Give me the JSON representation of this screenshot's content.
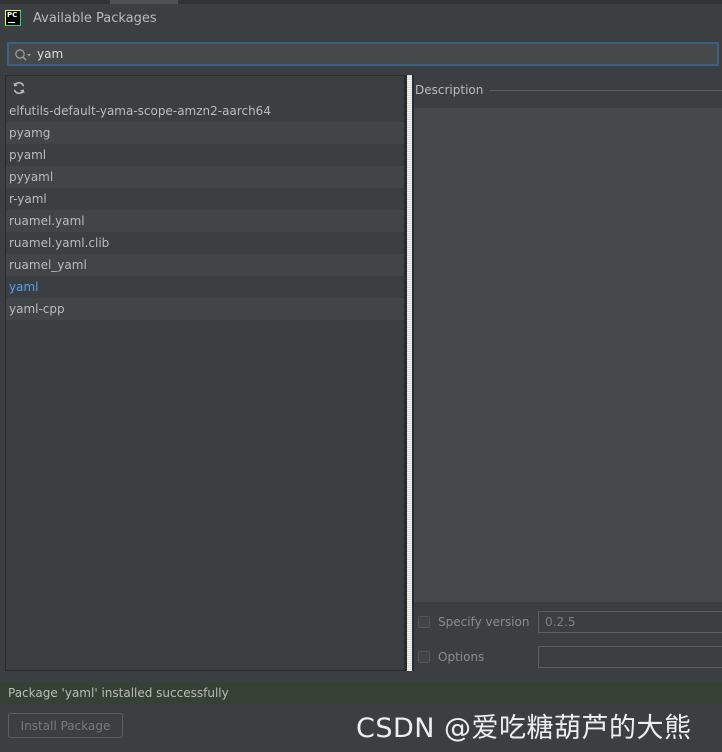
{
  "window": {
    "title": "Available Packages"
  },
  "search": {
    "value": "yam",
    "icon": "search-icon"
  },
  "package_list": {
    "refresh_icon": "refresh-icon",
    "items": [
      {
        "name": "elfutils-default-yama-scope-amzn2-aarch64",
        "installed": false
      },
      {
        "name": "pyamg",
        "installed": false
      },
      {
        "name": "pyaml",
        "installed": false
      },
      {
        "name": "pyyaml",
        "installed": false
      },
      {
        "name": "r-yaml",
        "installed": false
      },
      {
        "name": "ruamel.yaml",
        "installed": false
      },
      {
        "name": "ruamel.yaml.clib",
        "installed": false
      },
      {
        "name": "ruamel_yaml",
        "installed": false
      },
      {
        "name": "yaml",
        "installed": true
      },
      {
        "name": "yaml-cpp",
        "installed": false
      }
    ]
  },
  "details": {
    "description_label": "Description",
    "specify_version_label": "Specify version",
    "version_value": "0.2.5",
    "options_label": "Options",
    "options_value": ""
  },
  "status": {
    "message": "Package 'yaml' installed successfully"
  },
  "actions": {
    "install_label": "Install Package"
  },
  "watermark": {
    "text": "CSDN @爱吃糖葫芦的大熊"
  },
  "colors": {
    "background": "#3c3f41",
    "installed_package": "#589df6",
    "status_success_bg": "#344134",
    "search_focus_border": "#3d6185"
  }
}
